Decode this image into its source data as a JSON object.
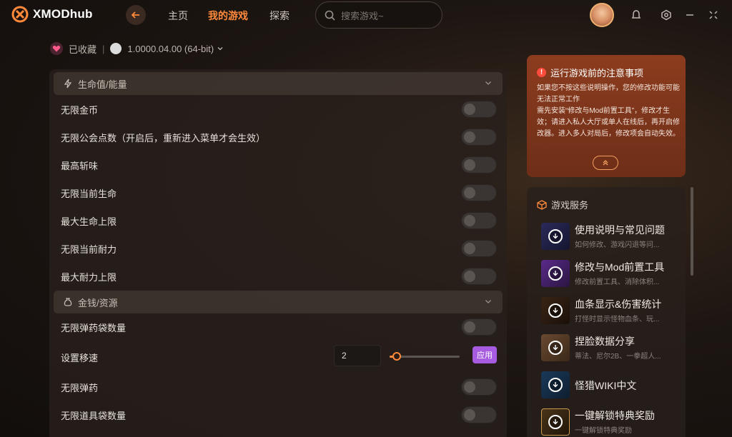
{
  "app": {
    "name": "XMODhub"
  },
  "nav": {
    "home": "主页",
    "my_games": "我的游戏",
    "explore": "探索"
  },
  "search": {
    "placeholder": "搜索游戏~"
  },
  "subbar": {
    "favorited": "已收藏",
    "divider": "|",
    "version": "1.0000.04.00 (64-bit)"
  },
  "sections": [
    {
      "title": "生命值/能量",
      "icon": "bolt-icon"
    },
    {
      "title": "金钱/资源",
      "icon": "money-bag-icon"
    }
  ],
  "rows": {
    "r0": "无限金币",
    "r1": "无限公会点数（开启后，重新进入菜单才会生效）",
    "r2": "最高斩味",
    "r3": "无限当前生命",
    "r4": "最大生命上限",
    "r5": "无限当前耐力",
    "r6": "最大耐力上限",
    "r7": "无限弹药袋数量",
    "r8": "设置移速",
    "r9": "无限弹药",
    "r10": "无限道具袋数量"
  },
  "speed": {
    "value": "2",
    "slider_fraction": 0.1,
    "apply_label": "应用"
  },
  "notice": {
    "title": "运行游戏前的注意事项",
    "line1": "如果您不按这些说明操作，您的修改功能可能无法正常工作",
    "line2": "需先安装“修改与Mod前置工具”，修改才生效；请进入私人大厅或单人在线后，再开启修改器。进入多人对局后，修改项会自动失效。"
  },
  "services": {
    "title": "游戏服务",
    "items": [
      {
        "title": "使用说明与常见问题",
        "sub": "如何修改、游戏闪退等问..."
      },
      {
        "title": "修改与Mod前置工具",
        "sub": "修改前置工具、消除体积..."
      },
      {
        "title": "血条显示&伤害统计",
        "sub": "打怪时显示怪物血条、玩..."
      },
      {
        "title": "捏脸数据分享",
        "sub": "蒂法、尼尔2B、一拳超人..."
      },
      {
        "title": "怪猎WIKI中文",
        "sub": ""
      },
      {
        "title": "一键解锁特典奖励",
        "sub": "一键解锁特典奖励"
      }
    ]
  },
  "colors": {
    "accent": "#ff8a3c",
    "apply": "#a65be0",
    "notice": "#8c3c1e"
  }
}
